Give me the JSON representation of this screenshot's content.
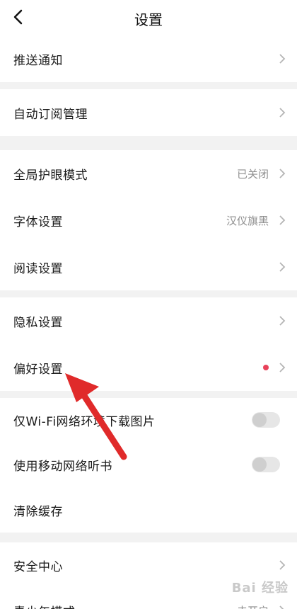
{
  "header": {
    "title": "设置"
  },
  "sections": [
    {
      "items": [
        {
          "label": "推送通知"
        }
      ]
    },
    {
      "items": [
        {
          "label": "自动订阅管理"
        }
      ]
    },
    {
      "items": [
        {
          "label": "全局护眼模式",
          "value": "已关闭"
        },
        {
          "label": "字体设置",
          "value": "汉仪旗黑"
        },
        {
          "label": "阅读设置"
        }
      ]
    },
    {
      "items": [
        {
          "label": "隐私设置"
        },
        {
          "label": "偏好设置",
          "badge": "red-dot"
        }
      ]
    },
    {
      "items": [
        {
          "label": "仅Wi-Fi网络环境下载图片",
          "toggle": "off"
        },
        {
          "label": "使用移动网络听书",
          "toggle": "off"
        },
        {
          "label": "清除缓存"
        }
      ]
    },
    {
      "items": [
        {
          "label": "安全中心"
        },
        {
          "label": "青少年模式",
          "value": "未开启"
        }
      ]
    }
  ],
  "watermark": {
    "text": "Bai 经验"
  },
  "colors": {
    "accent_red": "#e8425a",
    "arrow_red": "#e02a2a",
    "divider": "#f2f2f2"
  },
  "icons": {
    "back": "chevron-left-icon",
    "row_chevron": "chevron-right-icon"
  }
}
